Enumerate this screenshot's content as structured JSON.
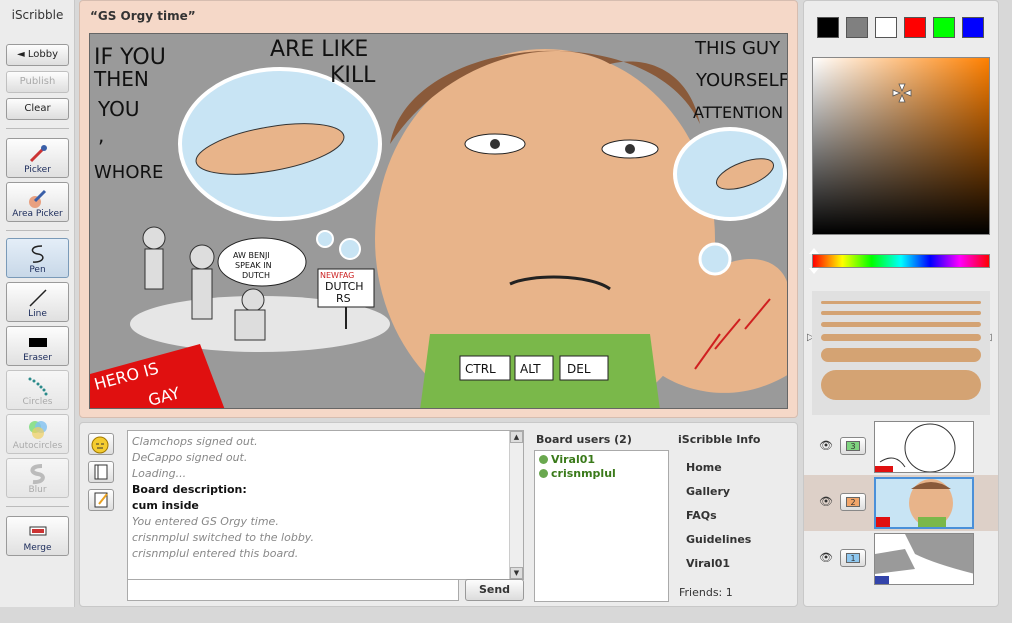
{
  "app": {
    "name": "iScribble"
  },
  "toolbar": {
    "lobby": "◄ Lobby",
    "publish": "Publish",
    "clear": "Clear",
    "tools": [
      {
        "label": "Picker"
      },
      {
        "label": "Area Picker"
      },
      {
        "label": "Pen"
      },
      {
        "label": "Line"
      },
      {
        "label": "Eraser"
      },
      {
        "label": "Circles"
      },
      {
        "label": "Autocircles"
      },
      {
        "label": "Blur"
      },
      {
        "label": "Merge"
      }
    ]
  },
  "board": {
    "title": "“GS Orgy time”",
    "drawing_texts": {
      "t1": "IF YOU",
      "t2": "THEN",
      "t3": "YOU",
      "t4": ",",
      "t5": "WHORE",
      "t6": "ARE LIKE",
      "t7": "KILL",
      "t8": "THIS GUY",
      "t9": "YOURSELF",
      "t10": "ATTENTION",
      "t11": "AW BENJI",
      "t12": "SPEAK IN",
      "t13": "DUTCH",
      "t14": "NEWFAG",
      "t15": "DUTCH",
      "t16": "RS",
      "t17": "CTRL",
      "t18": "ALT",
      "t19": "DEL",
      "t20": "HERO IS",
      "t21": "GAY"
    }
  },
  "chat": {
    "messages": [
      {
        "text": "Clamchops signed out.",
        "bold": false
      },
      {
        "text": "DeCappo signed out.",
        "bold": false
      },
      {
        "text": "Loading...",
        "bold": false
      },
      {
        "text": "Board description:",
        "bold": true
      },
      {
        "text": "cum inside",
        "bold": true
      },
      {
        "text": "You entered GS Orgy time.",
        "bold": false
      },
      {
        "text": "crisnmplul switched to the lobby.",
        "bold": false
      },
      {
        "text": "crisnmplul entered this board.",
        "bold": false
      }
    ],
    "input_value": "",
    "send_label": "Send"
  },
  "users": {
    "title": "Board users (2)",
    "list": [
      "Viral01",
      "crisnmplul"
    ]
  },
  "info": {
    "title": "iScribble Info",
    "links": [
      "Home",
      "Gallery",
      "FAQs",
      "Guidelines",
      "Viral01"
    ],
    "friends": "Friends: 1"
  },
  "colors": {
    "swatches": [
      "#000000",
      "#808080",
      "#ffffff",
      "#ff0000",
      "#00ff00",
      "#0000ff"
    ],
    "current": "#d4a373"
  },
  "layers": [
    {
      "number": "3",
      "active": false,
      "color": "#7fd47f"
    },
    {
      "number": "2",
      "active": true,
      "color": "#f2a66a"
    },
    {
      "number": "1",
      "active": false,
      "color": "#8fc8f0"
    }
  ]
}
